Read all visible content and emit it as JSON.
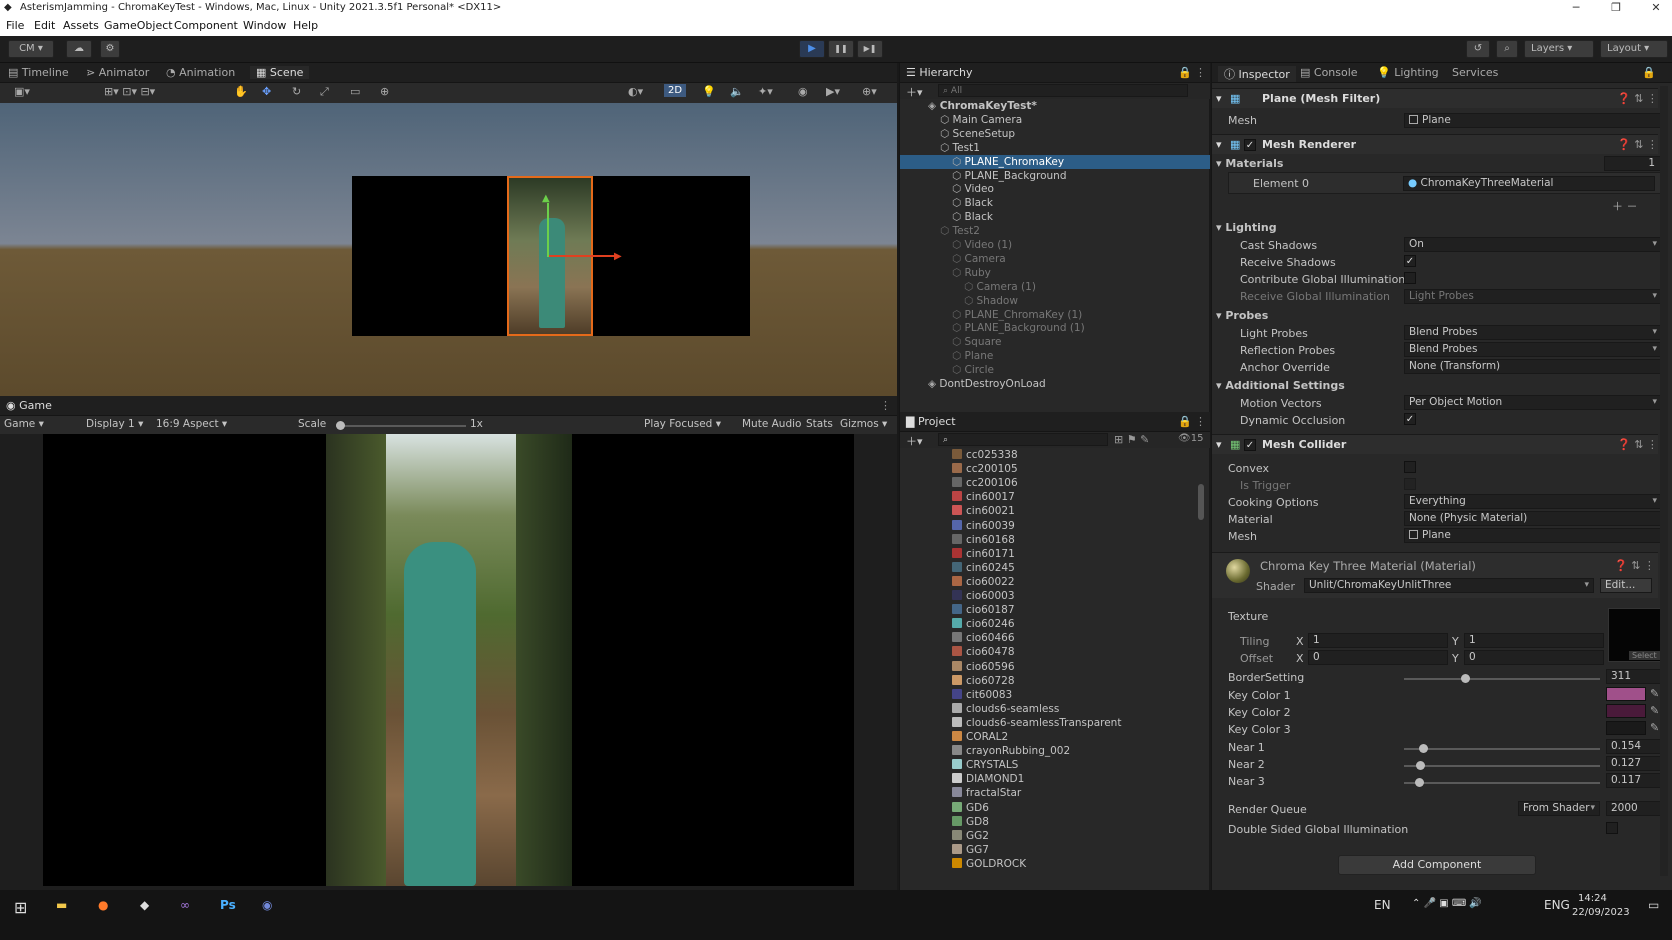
{
  "window": {
    "title": "AsterismJamming - ChromaKeyTest - Windows, Mac, Linux - Unity 2021.3.5f1 Personal* <DX11>",
    "min": "─",
    "max": "❐",
    "close": "✕"
  },
  "menu": [
    "File",
    "Edit",
    "Assets",
    "GameObject",
    "Component",
    "Window",
    "Help"
  ],
  "toolbar": {
    "account": "CM",
    "layers": "Layers",
    "layout": "Layout",
    "play": "▶",
    "pause": "❚❚",
    "step": "▶❚"
  },
  "scene_tabs": [
    "Timeline",
    "Animator",
    "Animation",
    "Scene"
  ],
  "scene_toolbar": {
    "mode2d": "2D"
  },
  "game": {
    "tab": "Game",
    "mode": "Game",
    "display": "Display 1",
    "aspect": "16:9 Aspect",
    "scale_label": "Scale",
    "scale_value": "1x",
    "play_focused": "Play Focused",
    "mute": "Mute Audio",
    "stats": "Stats",
    "gizmos": "Gizmos"
  },
  "hierarchy": {
    "tab": "Hierarchy",
    "search": "All",
    "items": [
      {
        "label": "ChromaKeyTest*",
        "indent": 0,
        "dim": false,
        "bold": true
      },
      {
        "label": "Main Camera",
        "indent": 1,
        "dim": false
      },
      {
        "label": "SceneSetup",
        "indent": 1,
        "dim": false
      },
      {
        "label": "Test1",
        "indent": 1,
        "dim": false
      },
      {
        "label": "PLANE_ChromaKey",
        "indent": 2,
        "dim": false,
        "selected": true
      },
      {
        "label": "PLANE_Background",
        "indent": 2,
        "dim": false
      },
      {
        "label": "Video",
        "indent": 2,
        "dim": false
      },
      {
        "label": "Black",
        "indent": 2,
        "dim": false
      },
      {
        "label": "Black",
        "indent": 2,
        "dim": false
      },
      {
        "label": "Test2",
        "indent": 1,
        "dim": true
      },
      {
        "label": "Video (1)",
        "indent": 2,
        "dim": true
      },
      {
        "label": "Camera",
        "indent": 2,
        "dim": true
      },
      {
        "label": "Ruby",
        "indent": 2,
        "dim": true
      },
      {
        "label": "Camera (1)",
        "indent": 3,
        "dim": true
      },
      {
        "label": "Shadow",
        "indent": 3,
        "dim": true
      },
      {
        "label": "PLANE_ChromaKey (1)",
        "indent": 2,
        "dim": true
      },
      {
        "label": "PLANE_Background (1)",
        "indent": 2,
        "dim": true
      },
      {
        "label": "Square",
        "indent": 2,
        "dim": true
      },
      {
        "label": "Plane",
        "indent": 2,
        "dim": true
      },
      {
        "label": "Circle",
        "indent": 2,
        "dim": true
      },
      {
        "label": "DontDestroyOnLoad",
        "indent": 0,
        "dim": false
      }
    ]
  },
  "project": {
    "tab": "Project",
    "count": "15",
    "items": [
      "cc025338",
      "cc200105",
      "cc200106",
      "cin60017",
      "cin60021",
      "cin60039",
      "cin60168",
      "cin60171",
      "cin60245",
      "cio60022",
      "cio60003",
      "cio60187",
      "cio60246",
      "cio60466",
      "cio60478",
      "cio60596",
      "cio60728",
      "cit60083",
      "clouds6-seamless",
      "clouds6-seamlessTransparent",
      "CORAL2",
      "crayonRubbing_002",
      "CRYSTALS",
      "DIAMOND1",
      "fractalStar",
      "GD6",
      "GD8",
      "GG2",
      "GG7",
      "GOLDROCK"
    ],
    "colors": [
      "#7a5a3a",
      "#9a6a4a",
      "#666",
      "#b44",
      "#c55",
      "#56a",
      "#666",
      "#a33",
      "#467",
      "#a64",
      "#335",
      "#468",
      "#5aa",
      "#777",
      "#a54",
      "#a86",
      "#c96",
      "#448",
      "#aaa",
      "#bbb",
      "#c84",
      "#888",
      "#9cc",
      "#ccc",
      "#889",
      "#7a7",
      "#696",
      "#887",
      "#a98",
      "#c80"
    ]
  },
  "inspector": {
    "tabs": [
      "Inspector",
      "Console",
      "Lighting",
      "Services"
    ],
    "mesh_filter": {
      "title": "Plane (Mesh Filter)",
      "mesh_label": "Mesh",
      "mesh_value": "Plane"
    },
    "mesh_renderer": {
      "title": "Mesh Renderer",
      "materials_label": "Materials",
      "materials_count": "1",
      "element_label": "Element 0",
      "element_value": "ChromaKeyThreeMaterial",
      "lighting": "Lighting",
      "cast_label": "Cast Shadows",
      "cast_value": "On",
      "receive_label": "Receive Shadows",
      "contribute_label": "Contribute Global Illumination",
      "receive_gi_label": "Receive Global Illumination",
      "receive_gi_value": "Light Probes",
      "probes": "Probes",
      "light_probes_label": "Light Probes",
      "light_probes_value": "Blend Probes",
      "reflection_label": "Reflection Probes",
      "reflection_value": "Blend Probes",
      "anchor_label": "Anchor Override",
      "anchor_value": "None (Transform)",
      "additional": "Additional Settings",
      "motion_label": "Motion Vectors",
      "motion_value": "Per Object Motion",
      "occlusion_label": "Dynamic Occlusion"
    },
    "mesh_collider": {
      "title": "Mesh Collider",
      "convex_label": "Convex",
      "trigger_label": "Is Trigger",
      "cooking_label": "Cooking Options",
      "cooking_value": "Everything",
      "material_label": "Material",
      "material_value": "None (Physic Material)",
      "mesh_label": "Mesh",
      "mesh_value": "Plane"
    },
    "material": {
      "title": "Chroma Key Three Material (Material)",
      "shader_label": "Shader",
      "shader_value": "Unlit/ChromaKeyUnlitThree",
      "edit": "Edit...",
      "texture_label": "Texture",
      "select": "Select",
      "tiling_label": "Tiling",
      "offset_label": "Offset",
      "x": "X",
      "y": "Y",
      "tiling_x": "1",
      "tiling_y": "1",
      "offset_x": "0",
      "offset_y": "0",
      "border_label": "BorderSetting",
      "border_value": "311",
      "border_frac": 0.31,
      "key1_label": "Key Color 1",
      "key2_label": "Key Color 2",
      "key3_label": "Key Color 3",
      "key1_color": "#a0508a",
      "key2_color": "#4a1a3a",
      "key3_color": "#1a1a1a",
      "near1_label": "Near 1",
      "near1_value": "0.154",
      "near1_frac": 0.096,
      "near2_label": "Near 2",
      "near2_value": "0.127",
      "near2_frac": 0.083,
      "near3_label": "Near 3",
      "near3_value": "0.117",
      "near3_frac": 0.078,
      "queue_label": "Render Queue",
      "queue_mode": "From Shader",
      "queue_value": "2000",
      "dsgi_label": "Double Sided Global Illumination"
    },
    "add_component": "Add Component"
  },
  "taskbar": {
    "lang": "EN",
    "lang2": "ENG",
    "time": "14:24",
    "date": "22/09/2023",
    "start": "⊞"
  }
}
